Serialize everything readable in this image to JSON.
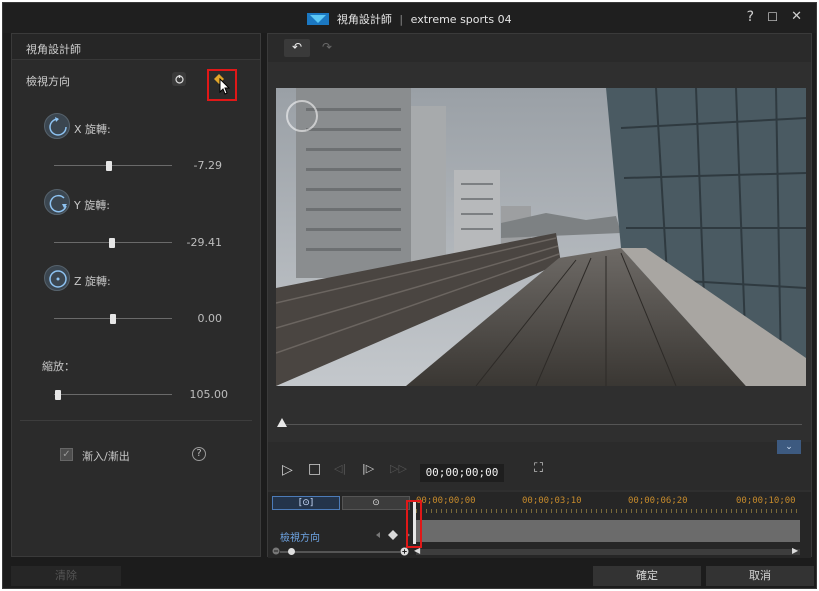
{
  "window": {
    "app_name": "視角設計師",
    "separator": "|",
    "project_name": "extreme sports 04",
    "help_glyph": "?",
    "maximize_glyph": "☐",
    "close_glyph": "✕"
  },
  "left_panel": {
    "header": "視角設計師",
    "section_title": "檢視方向",
    "rotations": [
      {
        "label": "X 旋轉:",
        "value": "-7.29",
        "slider_fraction": 0.47
      },
      {
        "label": "Y 旋轉:",
        "value": "-29.41",
        "slider_fraction": 0.49
      },
      {
        "label": "Z 旋轉:",
        "value": "0.00",
        "slider_fraction": 0.5
      }
    ],
    "zoom": {
      "label": "縮放：",
      "value": "105.00",
      "slider_fraction": 0.03
    },
    "fade_checkbox": {
      "label": "漸入/漸出",
      "checked": true
    },
    "help_glyph": "?"
  },
  "toolbar": {
    "undo_glyph": "↶",
    "redo_glyph": "↷"
  },
  "playback": {
    "play_glyph": "▷",
    "stop_glyph": "□",
    "prev_frame_glyph": "◁|",
    "next_frame_glyph": "|▷",
    "fast_forward_glyph": "▷▷",
    "timecode": "00;00;00;00",
    "fullscreen_glyph": "⛶",
    "collapse_glyph": "⌄",
    "scrub_fraction": 0.0
  },
  "timeline": {
    "tabs": [
      "[⊙]",
      "⊙"
    ],
    "time_marks": [
      "00;00;00;00",
      "00;00;03;10",
      "00;00;06;20",
      "00;00;10;00"
    ],
    "track_label": "檢視方向"
  },
  "footer": {
    "reset_label": "清除",
    "ok_label": "確定",
    "cancel_label": "取消"
  },
  "colors": {
    "highlight": "#e01818",
    "accent_blue": "#4c7bb8",
    "timeline_time": "#c58a2c"
  }
}
